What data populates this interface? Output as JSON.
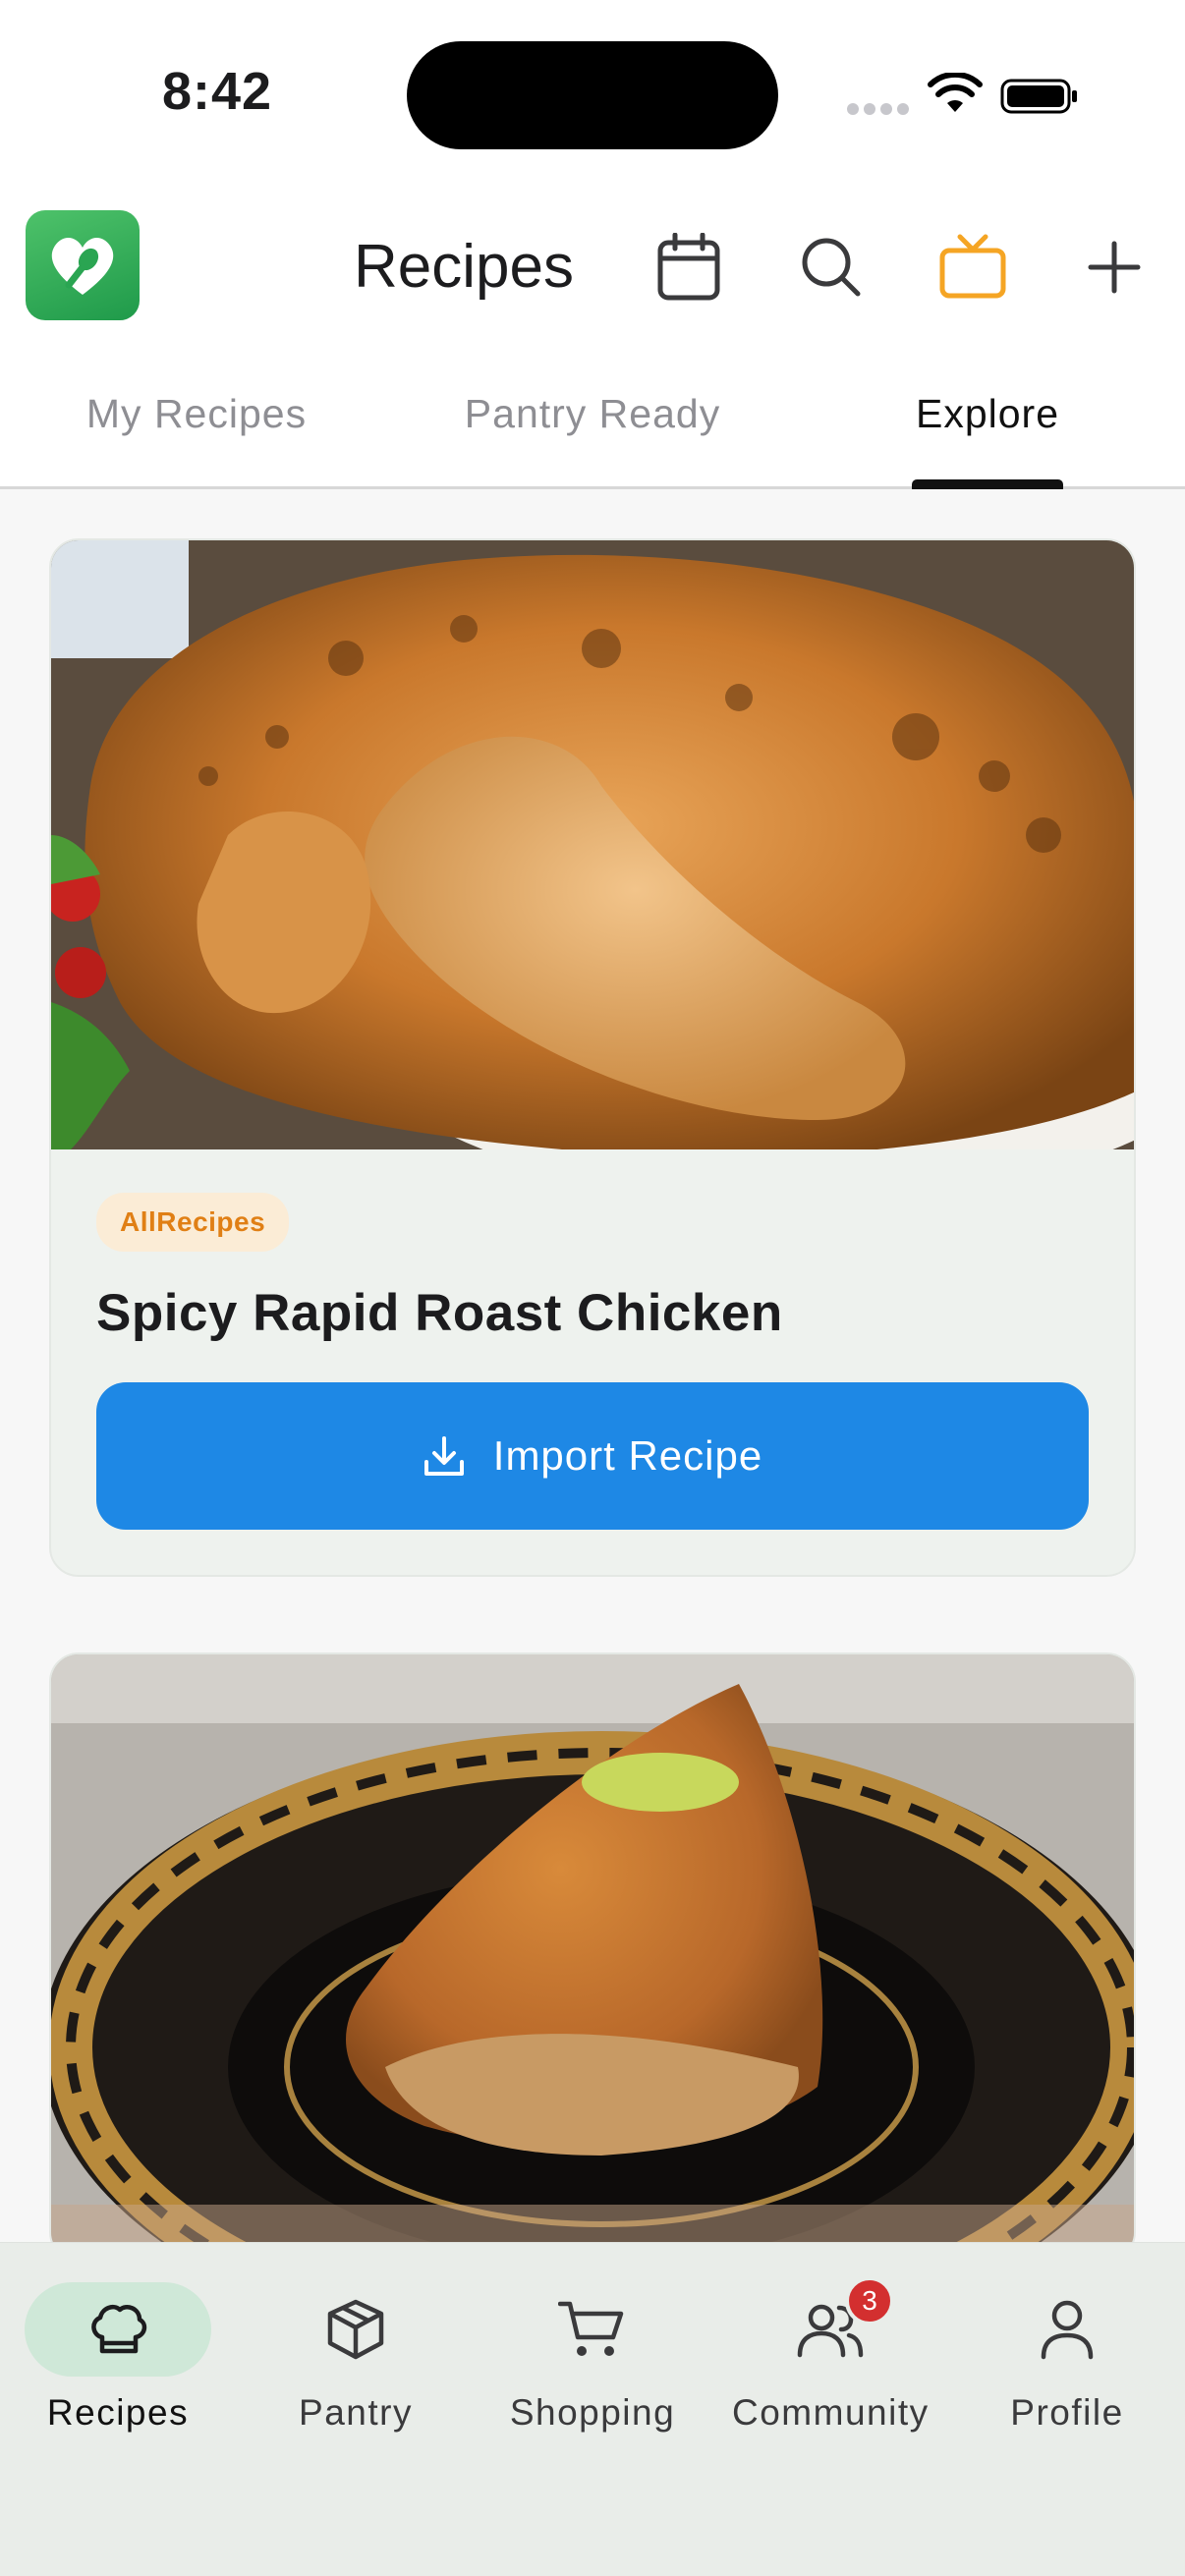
{
  "status_bar": {
    "time": "8:42"
  },
  "header": {
    "title": "Recipes",
    "accent_color": "#f5a524",
    "icons": [
      "calendar-icon",
      "search-icon",
      "tv-icon",
      "plus-icon"
    ]
  },
  "tabs": [
    {
      "label": "My Recipes",
      "active": false
    },
    {
      "label": "Pantry Ready",
      "active": false
    },
    {
      "label": "Explore",
      "active": true
    }
  ],
  "recipes": [
    {
      "source": "AllRecipes",
      "title": "Spicy Rapid Roast Chicken",
      "action_label": "Import Recipe",
      "image": "roast-chicken-photo"
    },
    {
      "image": "dessert-cake-photo"
    }
  ],
  "bottom_nav": {
    "items": [
      {
        "label": "Recipes",
        "icon": "chef-hat-icon",
        "active": true
      },
      {
        "label": "Pantry",
        "icon": "box-icon",
        "active": false
      },
      {
        "label": "Shopping",
        "icon": "cart-icon",
        "active": false
      },
      {
        "label": "Community",
        "icon": "users-icon",
        "active": false,
        "badge": "3"
      },
      {
        "label": "Profile",
        "icon": "person-icon",
        "active": false
      }
    ]
  },
  "colors": {
    "brand_green": "#2fb35a",
    "primary_blue": "#1e88e5",
    "badge_red": "#d32f2f",
    "source_orange": "#e07f15"
  }
}
